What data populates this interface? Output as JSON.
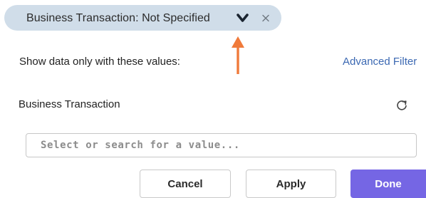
{
  "filter_chip": {
    "label": "Business Transaction: Not Specified",
    "chevron_icon": "chevron-down-icon",
    "close_icon": "close-icon"
  },
  "filter_panel": {
    "instruction": "Show data only with these values:",
    "advanced_link": "Advanced Filter",
    "section_title": "Business Transaction",
    "refresh_icon": "refresh-icon",
    "search": {
      "value": "",
      "placeholder": "Select or search for a value..."
    }
  },
  "actions": {
    "cancel_label": "Cancel",
    "apply_label": "Apply",
    "done_label": "Done"
  },
  "colors": {
    "chip_background": "#d0dde9",
    "arrow": "#f07a3a",
    "link": "#3b68b2",
    "primary_button": "#7566e4"
  }
}
